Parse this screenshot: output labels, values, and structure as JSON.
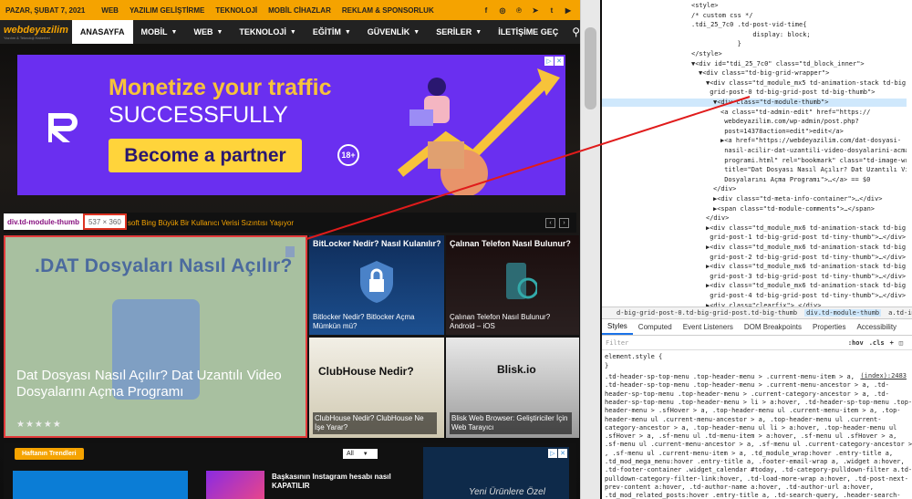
{
  "site": {
    "topbar": {
      "date": "PAZAR, ŞUBAT 7, 2021",
      "links": [
        "WEB",
        "YAZILIM GELİŞTİRME",
        "TEKNOLOJİ",
        "MOBİL CİHAZLAR",
        "REKLAM & SPONSORLUK"
      ],
      "socials": [
        "facebook-icon",
        "instagram-icon",
        "pinterest-icon",
        "telegram-icon",
        "twitter-icon",
        "youtube-icon"
      ]
    },
    "logo": {
      "name": "webdeyazilim",
      "tagline": "Yazılım & Teknoloji Haberleri"
    },
    "nav": [
      {
        "label": "ANASAYFA",
        "dropdown": false
      },
      {
        "label": "MOBİL",
        "dropdown": true
      },
      {
        "label": "WEB",
        "dropdown": true
      },
      {
        "label": "TEKNOLOJİ",
        "dropdown": true
      },
      {
        "label": "EĞİTİM",
        "dropdown": true
      },
      {
        "label": "GÜVENLİK",
        "dropdown": true
      },
      {
        "label": "SERİLER",
        "dropdown": true
      },
      {
        "label": "İLETİŞİME GEÇ",
        "dropdown": false
      }
    ],
    "ad": {
      "headline": "Monetize your traffic",
      "sub": "SUCCESSFULLY",
      "cta": "Become a partner",
      "age": "18+"
    },
    "ticker": "soft Bing Büyük Bir Kullanıcı Verisi Sızıntısı Yaşıyor",
    "inspect": {
      "selector": "div.td-module-thumb",
      "size": "537 × 360"
    },
    "big_post": {
      "image_title": ".DAT Dosyaları Nasıl Açılır?",
      "title": "Dat Dosyası Nasıl Açılır? Dat Uzantılı Video Dosyalarını Açma Programı",
      "rating": "★★★★★"
    },
    "tiles": [
      {
        "top": "BitLocker Nedir? Nasıl Kulanılır?",
        "caption": "Bitlocker Nedir? Bitlocker Açma Mümkün mü?"
      },
      {
        "top": "Çalınan Telefon Nasıl Bulunur?",
        "caption": "Çalınan Telefon Nasıl Bulunur? Android – iOS"
      },
      {
        "top": "ClubHouse Nedir?",
        "caption": "ClubHouse Nedir? ClubHouse Ne İşe Yarar?"
      },
      {
        "top": "Blisk.io",
        "caption": "Blisk Web Browser: Geliştiriciler İçin Web Tarayıcı"
      }
    ],
    "section2": {
      "tag": "Haftanın Trendleri",
      "select": "All",
      "post": "Başkasının Instagram hesabı nasıl KAPATILIR",
      "ad_text": "Yeni Ürünlere Özel"
    }
  },
  "devtools": {
    "dom": [
      {
        "indent": 0,
        "text": "<style>",
        "sel": false
      },
      {
        "indent": 0,
        "text": "/* custom css */",
        "sel": false
      },
      {
        "indent": 0,
        "text": ".tdi_25_7c0 .td-post-vid-time{",
        "sel": false
      },
      {
        "indent": 0,
        "text": "                display: block;",
        "sel": false
      },
      {
        "indent": 0,
        "text": "            }",
        "sel": false
      },
      {
        "indent": 0,
        "text": "</style>",
        "sel": false
      },
      {
        "indent": 0,
        "text": "▼<div id=\"tdi_25_7c0\" class=\"td_block_inner\">",
        "sel": false
      },
      {
        "indent": 1,
        "text": "▼<div class=\"td-big-grid-wrapper\">",
        "sel": false
      },
      {
        "indent": 2,
        "text": "▼<div class=\"td_module_mx5 td-animation-stack td-big-",
        "sel": false
      },
      {
        "indent": 2,
        "text": " grid-post-0 td-big-grid-post td-big-thumb\">",
        "sel": false
      },
      {
        "indent": 3,
        "text": "▼<div class=\"td-module-thumb\">",
        "sel": true
      },
      {
        "indent": 4,
        "text": "<a class=\"td-admin-edit\" href=\"https://",
        "sel": false
      },
      {
        "indent": 4,
        "text": " webdeyazilim.com/wp-admin/post.php?",
        "sel": false
      },
      {
        "indent": 4,
        "text": " post=14378action=edit\">edit</a>",
        "sel": false
      },
      {
        "indent": 4,
        "text": "▶<a href=\"https://webdeyazilim.com/dat-dosyasi-",
        "sel": false
      },
      {
        "indent": 4,
        "text": " nasil-acilir-dat-uzantili-video-dosyalarini-acma-",
        "sel": false
      },
      {
        "indent": 4,
        "text": " programi.html\" rel=\"bookmark\" class=\"td-image-wrap \"",
        "sel": false
      },
      {
        "indent": 4,
        "text": " title=\"Dat Dosyası Nasıl Açılır? Dat Uzantılı Video",
        "sel": false
      },
      {
        "indent": 4,
        "text": " Dosyalarını Açma Programı\">…</a> == $0",
        "sel": false
      },
      {
        "indent": 3,
        "text": "</div>",
        "sel": false
      },
      {
        "indent": 3,
        "text": "▶<div class=\"td-meta-info-container\">…</div>",
        "sel": false
      },
      {
        "indent": 3,
        "text": "▶<span class=\"td-module-comments\">…</span>",
        "sel": false
      },
      {
        "indent": 2,
        "text": "</div>",
        "sel": false
      },
      {
        "indent": 2,
        "text": "▶<div class=\"td_module_mx6 td-animation-stack td-big-",
        "sel": false
      },
      {
        "indent": 2,
        "text": " grid-post-1 td-big-grid-post td-tiny-thumb\">…</div>",
        "sel": false
      },
      {
        "indent": 2,
        "text": "▶<div class=\"td_module_mx6 td-animation-stack td-big-",
        "sel": false
      },
      {
        "indent": 2,
        "text": " grid-post-2 td-big-grid-post td-tiny-thumb\">…</div>",
        "sel": false
      },
      {
        "indent": 2,
        "text": "▶<div class=\"td_module_mx6 td-animation-stack td-big-",
        "sel": false
      },
      {
        "indent": 2,
        "text": " grid-post-3 td-big-grid-post td-tiny-thumb\">…</div>",
        "sel": false
      },
      {
        "indent": 2,
        "text": "▶<div class=\"td_module_mx6 td-animation-stack td-big-",
        "sel": false
      },
      {
        "indent": 2,
        "text": " grid-post-4 td-big-grid-post td-tiny-thumb\">…</div>",
        "sel": false
      },
      {
        "indent": 2,
        "text": "▶<div class=\"clearfix\">…</div>",
        "sel": false
      }
    ],
    "crumbs": [
      "d-big-grid-post-0.td-big-grid-post.td-big-thumb",
      "div.td-module-thumb",
      "a.td-image-wrap."
    ],
    "tabs": [
      "Styles",
      "Computed",
      "Event Listeners",
      "DOM Breakpoints",
      "Properties",
      "Accessibility"
    ],
    "filter": {
      "placeholder": "Filter",
      "hov": ":hov",
      "cls": ".cls",
      "plus": "+"
    },
    "element_style": [
      "element.style {",
      "}"
    ],
    "css_source": "(index):2483",
    "css_lines": [
      ".td-header-sp-top-menu .top-header-menu > .current-menu-item > a,",
      ".td-header-sp-top-menu .top-header-menu > .current-menu-ancestor > a, .td-",
      "header-sp-top-menu .top-header-menu > .current-category-ancestor > a, .td-",
      "header-sp-top-menu .top-header-menu > li > a:hover, .td-header-sp-top-menu .top-",
      "header-menu > .sfHover > a, .top-header-menu ul .current-menu-item > a, .top-",
      "header-menu ul .current-menu-ancestor > a, .top-header-menu ul .current-",
      "category-ancestor > a, .top-header-menu ul li > a:hover, .top-header-menu ul",
      ".sfHover > a, .sf-menu ul .td-menu-item > a:hover, .sf-menu ul .sfHover > a,",
      ".sf-menu ul .current-menu-ancestor > a, .sf-menu ul .current-category-ancestor > a",
      ", .sf-menu ul .current-menu-item > a, .td_module_wrap:hover .entry-title a,",
      ".td_mod_mega_menu:hover .entry-title a, .footer-email-wrap a, .widget a:hover,",
      ".td-footer-container .widget_calendar #today, .td-category-pulldown-filter a.td-",
      "pulldown-category-filter-link:hover, .td-load-more-wrap a:hover, .td-post-next-",
      "prev-content a:hover, .td-author-name a:hover, .td-author-url a:hover,",
      ".td_mod_related_posts:hover .entry-title a, .td-search-query, .header-search-",
      "wrap .td-drop-down-search .result-msg a:hover, .td_top_authors .td-active .td-"
    ]
  }
}
